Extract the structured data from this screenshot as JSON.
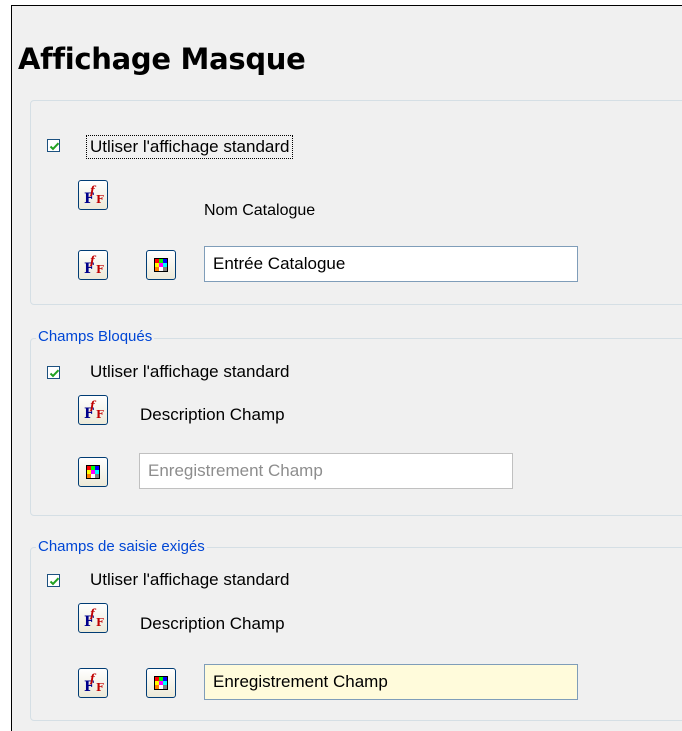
{
  "page_title": "Affichage Masque",
  "section_general": {
    "use_standard_label": "Utliser l'affichage standard",
    "use_standard_checked": true,
    "catalog_name_label": "Nom Catalogue",
    "catalog_entry_value": "Entrée Catalogue"
  },
  "section_blocked": {
    "title": "Champs Bloqués",
    "use_standard_label": "Utliser l'affichage standard",
    "use_standard_checked": true,
    "field_description_label": "Description Champ",
    "field_record_placeholder": "Enregistrement Champ"
  },
  "section_required": {
    "title": "Champs de saisie exigés",
    "use_standard_label": "Utliser l'affichage standard",
    "use_standard_checked": true,
    "field_description_label": "Description Champ",
    "field_record_value": "Enregistrement Champ"
  },
  "icons": {
    "font": "font-icon",
    "color": "color-palette-icon"
  },
  "colors": {
    "group_title": "#0046d5",
    "checkbox_check": "#21a121",
    "required_field_bg": "#fffbdb",
    "disabled_text": "#8d8d8d"
  }
}
